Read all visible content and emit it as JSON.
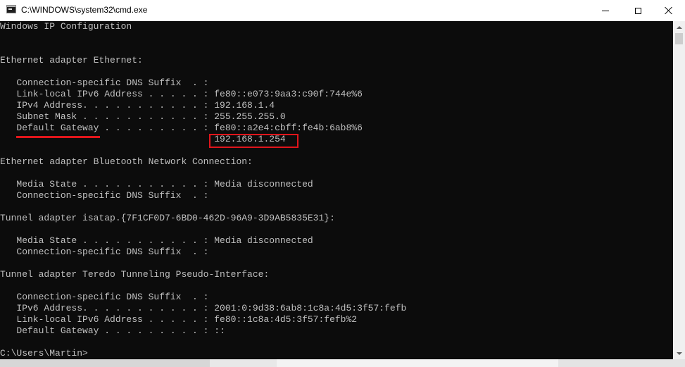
{
  "window": {
    "title": "C:\\WINDOWS\\system32\\cmd.exe",
    "icon": "cmd-icon",
    "controls": [
      "minimize-icon",
      "maximize-icon",
      "close-icon"
    ]
  },
  "console": {
    "background": "#0c0c0c",
    "text_color": "#c0c0c0",
    "lines": [
      "Windows IP Configuration",
      "",
      "",
      "Ethernet adapter Ethernet:",
      "",
      "   Connection-specific DNS Suffix  . :",
      "   Link-local IPv6 Address . . . . . : fe80::e073:9aa3:c90f:744e%6",
      "   IPv4 Address. . . . . . . . . . . : 192.168.1.4",
      "   Subnet Mask . . . . . . . . . . . : 255.255.255.0",
      "   Default Gateway . . . . . . . . . : fe80::a2e4:cbff:fe4b:6ab8%6",
      "                                       192.168.1.254",
      "",
      "Ethernet adapter Bluetooth Network Connection:",
      "",
      "   Media State . . . . . . . . . . . : Media disconnected",
      "   Connection-specific DNS Suffix  . :",
      "",
      "Tunnel adapter isatap.{7F1CF0D7-6BD0-462D-96A9-3D9AB5835E31}:",
      "",
      "   Media State . . . . . . . . . . . : Media disconnected",
      "   Connection-specific DNS Suffix  . :",
      "",
      "Tunnel adapter Teredo Tunneling Pseudo-Interface:",
      "",
      "   Connection-specific DNS Suffix  . :",
      "   IPv6 Address. . . . . . . . . . . : 2001:0:9d38:6ab8:1c8a:4d5:3f57:fefb",
      "   Link-local IPv6 Address . . . . . : fe80::1c8a:4d5:3f57:fefb%2",
      "   Default Gateway . . . . . . . . . : ::",
      "",
      "C:\\Users\\Martin>"
    ]
  },
  "annotations": {
    "color": "#e0151b",
    "underlined_label": "Default Gateway",
    "boxed_value": "192.168.1.254"
  }
}
